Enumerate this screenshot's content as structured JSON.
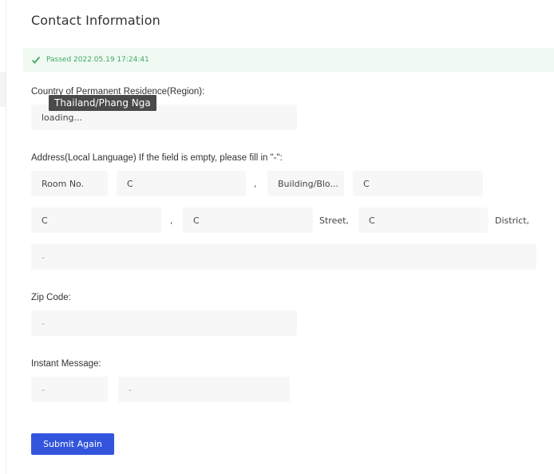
{
  "page": {
    "title": "Contact Information",
    "status_banner": "Passed 2022.05.19 17:24:41",
    "accent_color": "#3355dd",
    "success_color": "#3fa86a"
  },
  "country": {
    "label": "Country of Permanent Residence(Region):",
    "value": "loading...",
    "tooltip": "Thailand/Phang Nga"
  },
  "address": {
    "label": "Address(Local Language) If the field is empty, please fill in \"-\":",
    "row1": {
      "room_label": "Room No.",
      "room_value": "C",
      "sep": ",",
      "building_label": "Building/Blo...",
      "building_value": "C"
    },
    "row2": {
      "field1": "C",
      "sep": ",",
      "street_value": "C",
      "street_suffix": "Street,",
      "district_value": "C",
      "district_suffix": "District,"
    },
    "row3": {
      "value": "-"
    }
  },
  "zip": {
    "label": "Zip Code:",
    "value": "-"
  },
  "im": {
    "label": "Instant Message:",
    "type_value": "-",
    "id_value": "-"
  },
  "actions": {
    "submit_label": "Submit Again"
  }
}
